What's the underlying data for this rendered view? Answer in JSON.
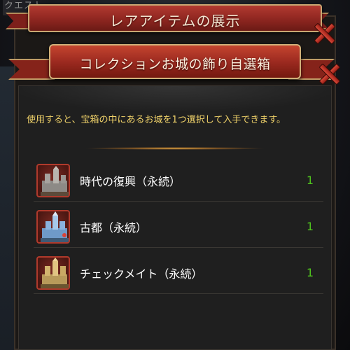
{
  "background": {
    "quest_tab": "クエスト"
  },
  "back_dialog": {
    "title": "レアアイテムの展示"
  },
  "front_dialog": {
    "title": "コレクションお城の飾り自選箱",
    "description": "使用すると、宝箱の中にあるお城を1つ選択して入手できます。",
    "items": [
      {
        "name": "時代の復興（永続）",
        "quantity": "1",
        "icon": "gray-castle-icon"
      },
      {
        "name": "古都（永続）",
        "quantity": "1",
        "icon": "blue-castle-icon"
      },
      {
        "name": "チェックメイト（永続）",
        "quantity": "1",
        "icon": "gold-castle-icon"
      }
    ]
  },
  "colors": {
    "banner_red": "#9d2a20",
    "description_yellow": "#f1d36a",
    "quantity_green": "#4ec21d",
    "panel_bg": "#1f1f1f"
  }
}
